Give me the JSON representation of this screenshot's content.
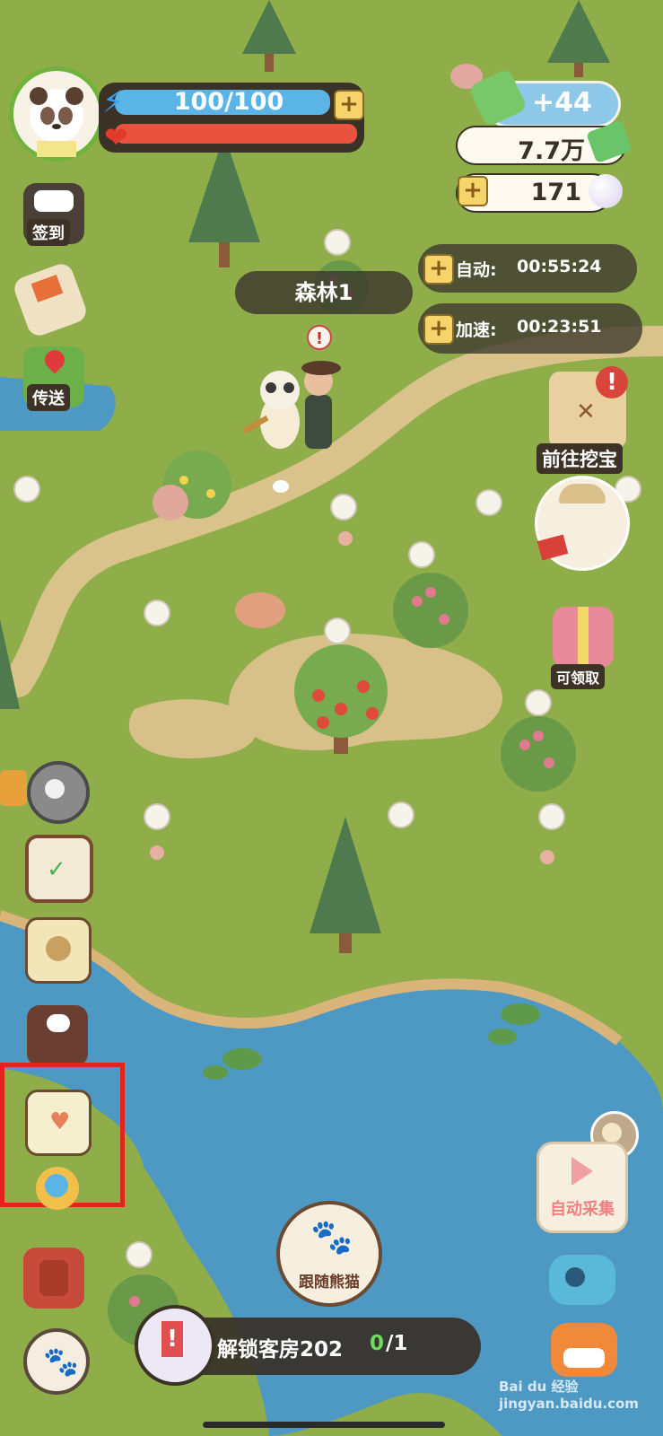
{
  "player": {
    "energy": "100/100"
  },
  "currency": {
    "income": "+44",
    "cash": "7.7万",
    "pearls": "171"
  },
  "location": {
    "name": "森林1"
  },
  "timers": {
    "auto_label": "自动:",
    "auto_time": "00:55:24",
    "speed_label": "加速:",
    "speed_time": "00:23:51"
  },
  "left_menu": {
    "checkin": "签到",
    "teleport": "传送"
  },
  "right_menu": {
    "treasure": "前往挖宝",
    "gift": "可领取",
    "auto_collect": "自动采集"
  },
  "bottom": {
    "follow": "跟随熊猫",
    "task_text": "解锁客房202",
    "task_done": "0",
    "task_total": "/1"
  },
  "watermark": "Bai du 经验 jingyan.baidu.com",
  "colors": {
    "grass": "#8fae4a",
    "water": "#4e98c4",
    "energy": "#5ab4e6",
    "health": "#ea5240",
    "highlight": "#e0261c"
  }
}
